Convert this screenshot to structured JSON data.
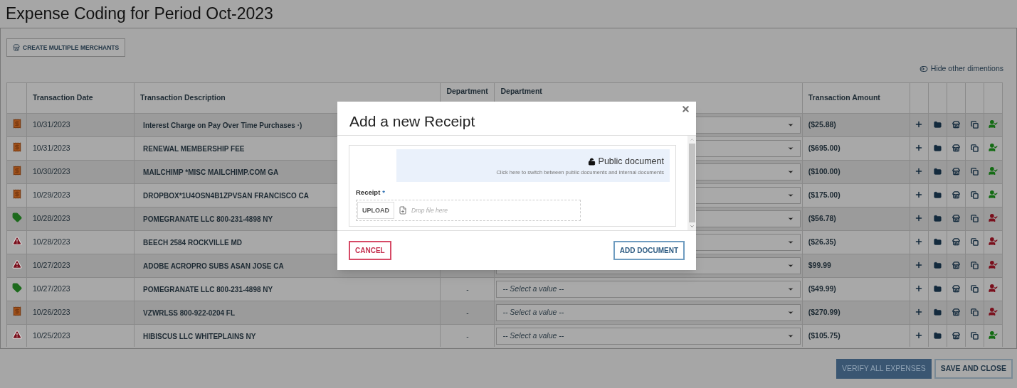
{
  "page": {
    "title": "Expense Coding for Period Oct-2023"
  },
  "toolbar": {
    "create_button": "CREATE MULTIPLE MERCHANTS",
    "hide_toggle": "Hide other dimentions"
  },
  "table": {
    "columns": [
      "Transaction Date",
      "Transaction Description",
      "Department",
      "Department",
      "Transaction Amount"
    ],
    "rows": [
      {
        "kind": "receipt",
        "date": "10/31/2023",
        "description": "Interest Charge on Pay Over Time Purchases ·)",
        "amount": "($25.88)",
        "verified": true
      },
      {
        "kind": "receipt",
        "date": "10/31/2023",
        "description": "RENEWAL MEMBERSHIP FEE",
        "amount": "($695.00)",
        "verified": true
      },
      {
        "kind": "receipt",
        "date": "10/30/2023",
        "description": "MAILCHIMP *MISC MAILCHIMP.COM GA",
        "amount": "($100.00)",
        "verified": true
      },
      {
        "kind": "receipt",
        "date": "10/29/2023",
        "description": "DROPBOX*1U4OSN4B1ZPVSAN FRANCISCO CA",
        "amount": "($175.00)",
        "verified": true
      },
      {
        "kind": "tag",
        "date": "10/28/2023",
        "description": "POMEGRANATE LLC 800-231-4898 NY",
        "amount": "($56.78)",
        "verified": false
      },
      {
        "kind": "warning",
        "date": "10/28/2023",
        "description": "BEECH 2584 ROCKVILLE MD",
        "amount": "($26.35)",
        "verified": false
      },
      {
        "kind": "warning",
        "date": "10/27/2023",
        "description": "ADOBE ACROPRO SUBS ASAN JOSE CA",
        "amount": "$99.99",
        "verified": false
      },
      {
        "kind": "tag",
        "date": "10/27/2023",
        "description": "POMEGRANATE LLC 800-231-4898 NY",
        "department": "-",
        "select_placeholder": "-- Select a value --",
        "amount": "($49.99)",
        "verified": false
      },
      {
        "kind": "receipt",
        "date": "10/26/2023",
        "description": "VZWRLSS 800-922-0204 FL",
        "department": "-",
        "select_placeholder": "-- Select a value --",
        "amount": "($270.99)",
        "verified": false
      },
      {
        "kind": "warning",
        "date": "10/25/2023",
        "description": "HIBISCUS LLC WHITEPLAINS NY",
        "department": "-",
        "select_placeholder": "-- Select a value --",
        "amount": "($105.75)",
        "verified": true
      }
    ]
  },
  "footer": {
    "buttons": [
      {
        "label": "VERIFY ALL EXPENSES",
        "kind": "primary"
      },
      {
        "label": "SAVE AND CLOSE",
        "kind": "secondary"
      }
    ]
  },
  "dialog": {
    "title": "Add a new Receipt",
    "visibility": {
      "label": "Public document",
      "hint": "Click here to switch between public documents and internal documents"
    },
    "field": {
      "label": "Receipt",
      "required_mark": "*",
      "upload": "UPLOAD",
      "placeholder": "Drop file here"
    },
    "buttons": [
      {
        "label": "CANCEL",
        "kind": "cancel"
      },
      {
        "label": "ADD DOCUMENT",
        "kind": "confirm"
      }
    ]
  }
}
